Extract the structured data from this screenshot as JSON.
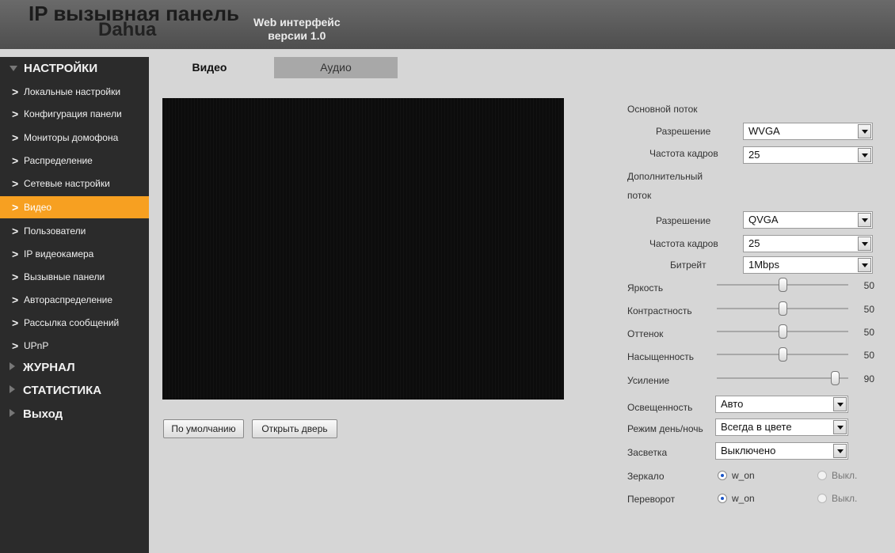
{
  "header": {
    "brand_line1": "IP вызывная панель",
    "brand_line2": "Dahua",
    "web_line1": "Web интерфейс",
    "web_line2": "версии 1.0"
  },
  "sidebar": {
    "settings_label": "НАСТРОЙКИ",
    "items": [
      {
        "label": "Локальные настройки"
      },
      {
        "label": "Конфигурация панели"
      },
      {
        "label": "Мониторы домофона"
      },
      {
        "label": "Распределение"
      },
      {
        "label": "Сетевые настройки"
      },
      {
        "label": "Видео",
        "active": true
      },
      {
        "label": "Пользователи"
      },
      {
        "label": "IP видеокамера"
      },
      {
        "label": "Вызывные панели"
      },
      {
        "label": "Автораспределение"
      },
      {
        "label": "Рассылка сообщений"
      },
      {
        "label": "UPnP"
      }
    ],
    "journal_label": "ЖУРНАЛ",
    "stats_label": "СТАТИСТИКА",
    "exit_label": "Выход",
    "accent_color": "#f7a021"
  },
  "tabs": {
    "video": "Видео",
    "audio": "Аудио"
  },
  "buttons": {
    "default": "По умолчанию",
    "open_door": "Открыть дверь"
  },
  "main_stream": {
    "title": "Основной поток",
    "resolution_label": "Разрешение",
    "resolution_value": "WVGA",
    "framerate_label": "Частота кадров",
    "framerate_value": "25"
  },
  "sub_stream": {
    "title_line1": "Дополнительный",
    "title_line2": "поток",
    "resolution_label": "Разрешение",
    "resolution_value": "QVGA",
    "framerate_label": "Частота кадров",
    "framerate_value": "25",
    "bitrate_label": "Битрейт",
    "bitrate_value": "1Mbps"
  },
  "image": {
    "brightness_label": "Яркость",
    "brightness_value": "50",
    "contrast_label": "Контрастность",
    "contrast_value": "50",
    "hue_label": "Оттенок",
    "hue_value": "50",
    "saturation_label": "Насыщенность",
    "saturation_value": "50",
    "gain_label": "Усиление",
    "gain_value": "90"
  },
  "exposure": {
    "illumination_label": "Освещенность",
    "illumination_value": "Авто",
    "daynight_label": "Режим день/ночь",
    "daynight_value": "Всегда в цвете",
    "backlight_label": "Засветка",
    "backlight_value": "Выключено"
  },
  "mirror": {
    "label": "Зеркало",
    "on_label": "w_on",
    "off_label": "Выкл.",
    "selected": "on"
  },
  "flip": {
    "label": "Переворот",
    "on_label": "w_on",
    "off_label": "Выкл.",
    "selected": "on"
  }
}
